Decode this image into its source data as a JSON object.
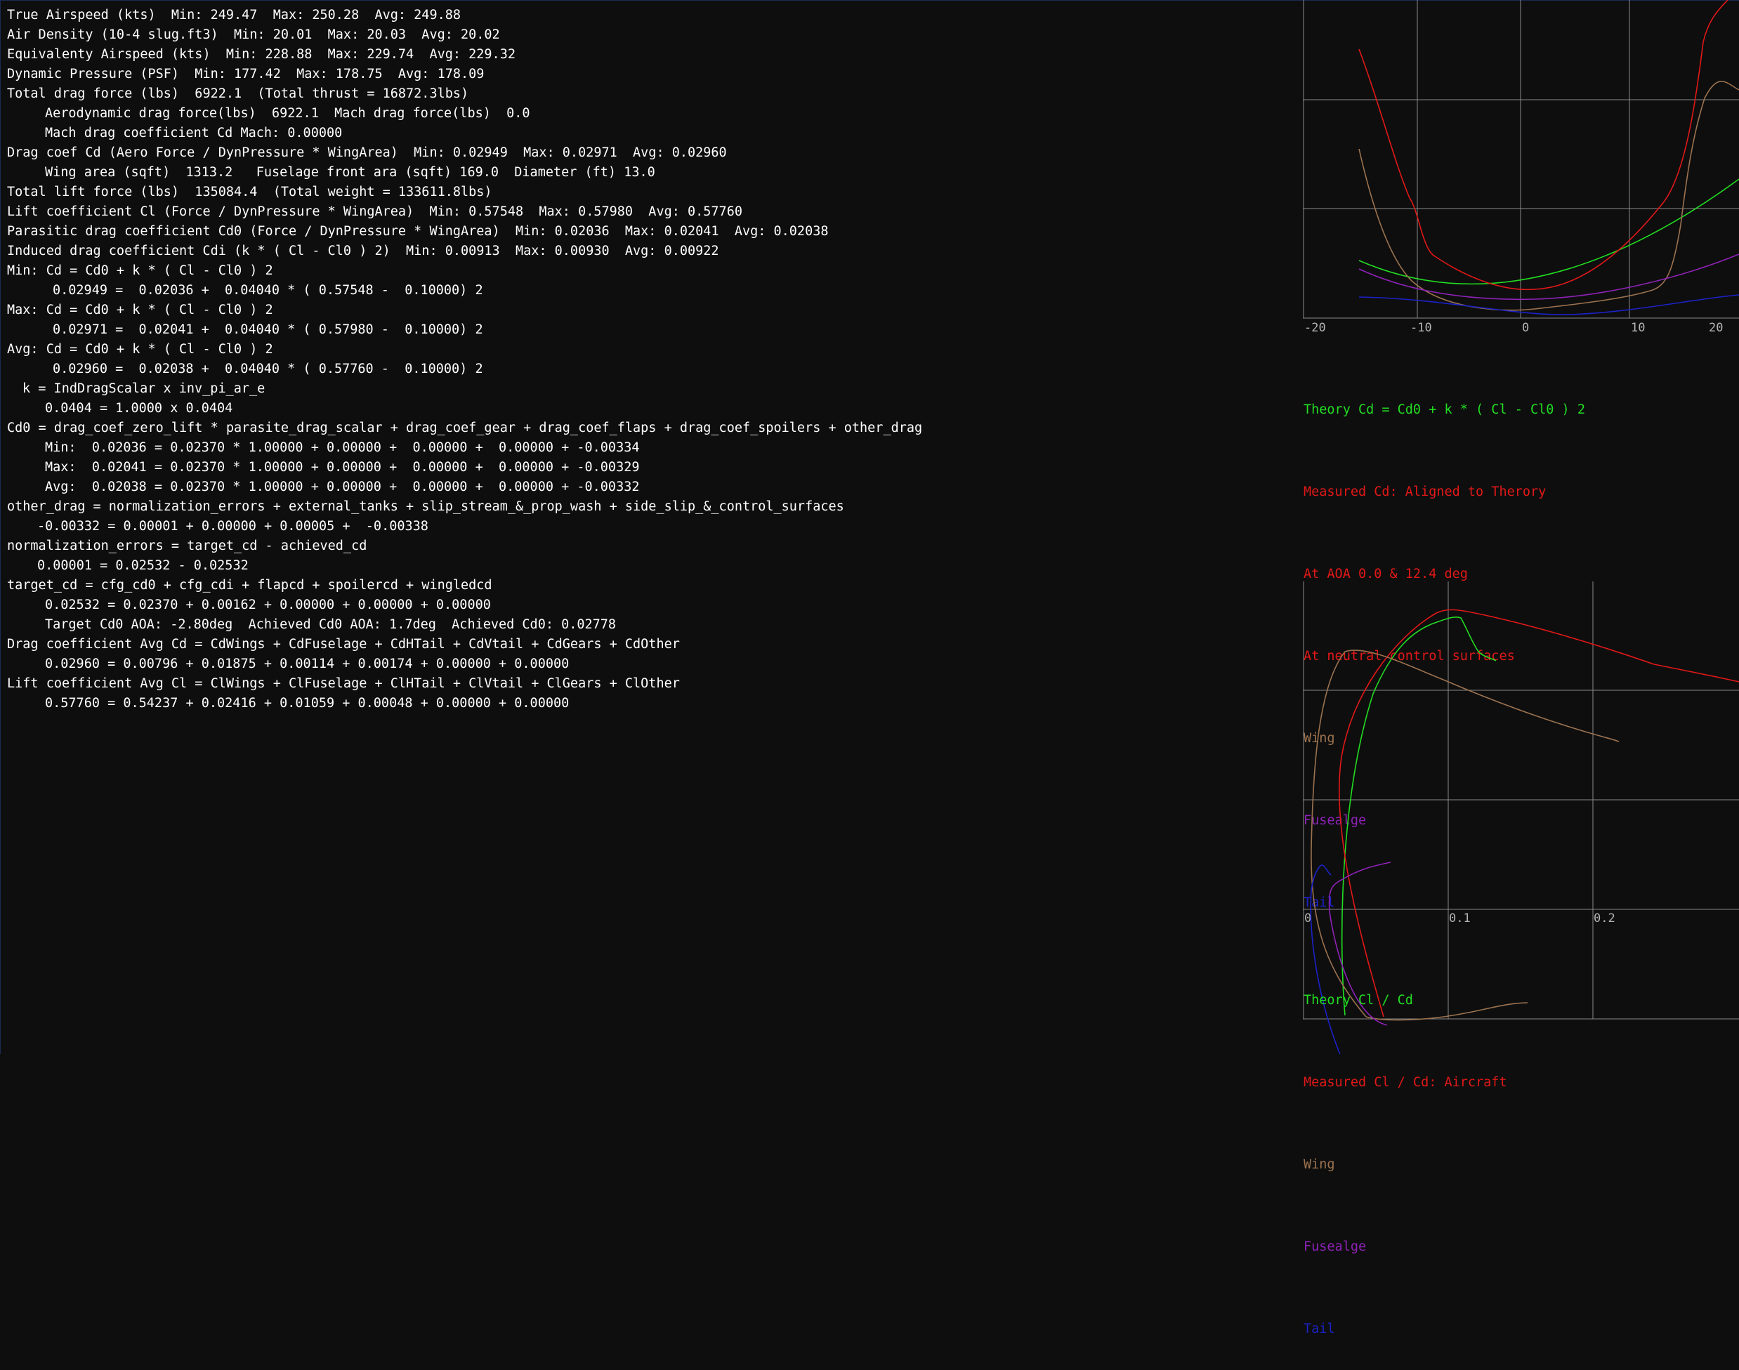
{
  "lines": [
    "True Airspeed (kts)  Min: 249.47  Max: 250.28  Avg: 249.88",
    "Air Density (10-4 slug.ft3)  Min: 20.01  Max: 20.03  Avg: 20.02",
    "Equivalenty Airspeed (kts)  Min: 228.88  Max: 229.74  Avg: 229.32",
    "Dynamic Pressure (PSF)  Min: 177.42  Max: 178.75  Avg: 178.09",
    "Total drag force (lbs)  6922.1  (Total thrust = 16872.3lbs)",
    "Aerodynamic drag force(lbs)  6922.1  Mach drag force(lbs)  0.0",
    "Mach drag coefficient Cd Mach: 0.00000",
    "Drag coef Cd (Aero Force / DynPressure * WingArea)  Min: 0.02949  Max: 0.02971  Avg: 0.02960",
    "Wing area (sqft)  1313.2   Fuselage front ara (sqft) 169.0  Diameter (ft) 13.0",
    "Total lift force (lbs)  135084.4  (Total weight = 133611.8lbs)",
    "Lift coefficient Cl (Force / DynPressure * WingArea)  Min: 0.57548  Max: 0.57980  Avg: 0.57760",
    "Parasitic drag coefficient Cd0 (Force / DynPressure * WingArea)  Min: 0.02036  Max: 0.02041  Avg: 0.02038",
    "Induced drag coefficient Cdi (k * ( Cl - Cl0 ) 2)  Min: 0.00913  Max: 0.00930  Avg: 0.00922",
    "Min: Cd = Cd0 + k * ( Cl - Cl0 ) 2",
    "0.02949 =  0.02036 +  0.04040 * ( 0.57548 -  0.10000) 2",
    "Max: Cd = Cd0 + k * ( Cl - Cl0 ) 2",
    "0.02971 =  0.02041 +  0.04040 * ( 0.57980 -  0.10000) 2",
    "Avg: Cd = Cd0 + k * ( Cl - Cl0 ) 2",
    "0.02960 =  0.02038 +  0.04040 * ( 0.57760 -  0.10000) 2",
    "k = IndDragScalar x inv_pi_ar_e",
    "0.0404 = 1.0000 x 0.0404",
    "Cd0 = drag_coef_zero_lift * parasite_drag_scalar + drag_coef_gear + drag_coef_flaps + drag_coef_spoilers + other_drag",
    "Min:  0.02036 = 0.02370 * 1.00000 + 0.00000 +  0.00000 +  0.00000 + -0.00334",
    "Max:  0.02041 = 0.02370 * 1.00000 + 0.00000 +  0.00000 +  0.00000 + -0.00329",
    "Avg:  0.02038 = 0.02370 * 1.00000 + 0.00000 +  0.00000 +  0.00000 + -0.00332",
    "other_drag = normalization_errors + external_tanks + slip_stream_&_prop_wash + side_slip_&_control_surfaces",
    "-0.00332 = 0.00001 + 0.00000 + 0.00005 +  -0.00338",
    "normalization_errors = target_cd - achieved_cd",
    "0.00001 = 0.02532 - 0.02532",
    "target_cd = cfg_cd0 + cfg_cdi + flapcd + spoilercd + wingledcd",
    "0.02532 = 0.02370 + 0.00162 + 0.00000 + 0.00000 + 0.00000",
    "Target Cd0 AOA: -2.80deg  Achieved Cd0 AOA: 1.7deg  Achieved Cd0: 0.02778",
    "Drag coefficient Avg Cd = CdWings + CdFuselage + CdHTail + CdVtail + CdGears + CdOther",
    "0.02960 = 0.00796 + 0.01875 + 0.00114 + 0.00174 + 0.00000 + 0.00000",
    "Lift coefficient Avg Cl = ClWings + ClFuselage + ClHTail + ClVtail + ClGears + ClOther",
    "0.57760 = 0.54237 + 0.02416 + 0.01059 + 0.00048 + 0.00000 + 0.00000"
  ],
  "colors": {
    "background": "#0e0e0e",
    "text": "#ffffff",
    "grid": "#8a8a8a",
    "axis_label": "#b4b4b4",
    "theory": "#22dd22",
    "measured": "#e21818",
    "wing": "#9c7350",
    "fuselage": "#8f22b8",
    "tail": "#1b22c8"
  },
  "graph1": {
    "x_ticks": [
      "-20",
      "-10",
      "0",
      "10",
      "20"
    ],
    "legend": [
      {
        "text": "Theory Cd = Cd0 + k * ( Cl - Cl0 ) 2",
        "color": "#22dd22"
      },
      {
        "text": "Measured Cd: Aligned to Therory",
        "color": "#e21818"
      },
      {
        "text": "At AOA 0.0 & 12.4 deg",
        "color": "#e21818"
      },
      {
        "text": "At neutral control surfaces",
        "color": "#e21818"
      },
      {
        "text": "Wing",
        "color": "#9c7350"
      },
      {
        "text": "Fusealge",
        "color": "#8f22b8"
      },
      {
        "text": "Tail",
        "color": "#1b22c8"
      }
    ]
  },
  "graph2": {
    "x_ticks": [
      "0",
      "0.1",
      "0.2"
    ],
    "legend": [
      {
        "text": "Theory Cl / Cd",
        "color": "#22dd22"
      },
      {
        "text": "Measured Cl / Cd: Aircraft",
        "color": "#e21818"
      },
      {
        "text": "Wing",
        "color": "#9c7350"
      },
      {
        "text": "Fusealge",
        "color": "#8f22b8"
      },
      {
        "text": "Tail",
        "color": "#1b22c8"
      }
    ]
  }
}
